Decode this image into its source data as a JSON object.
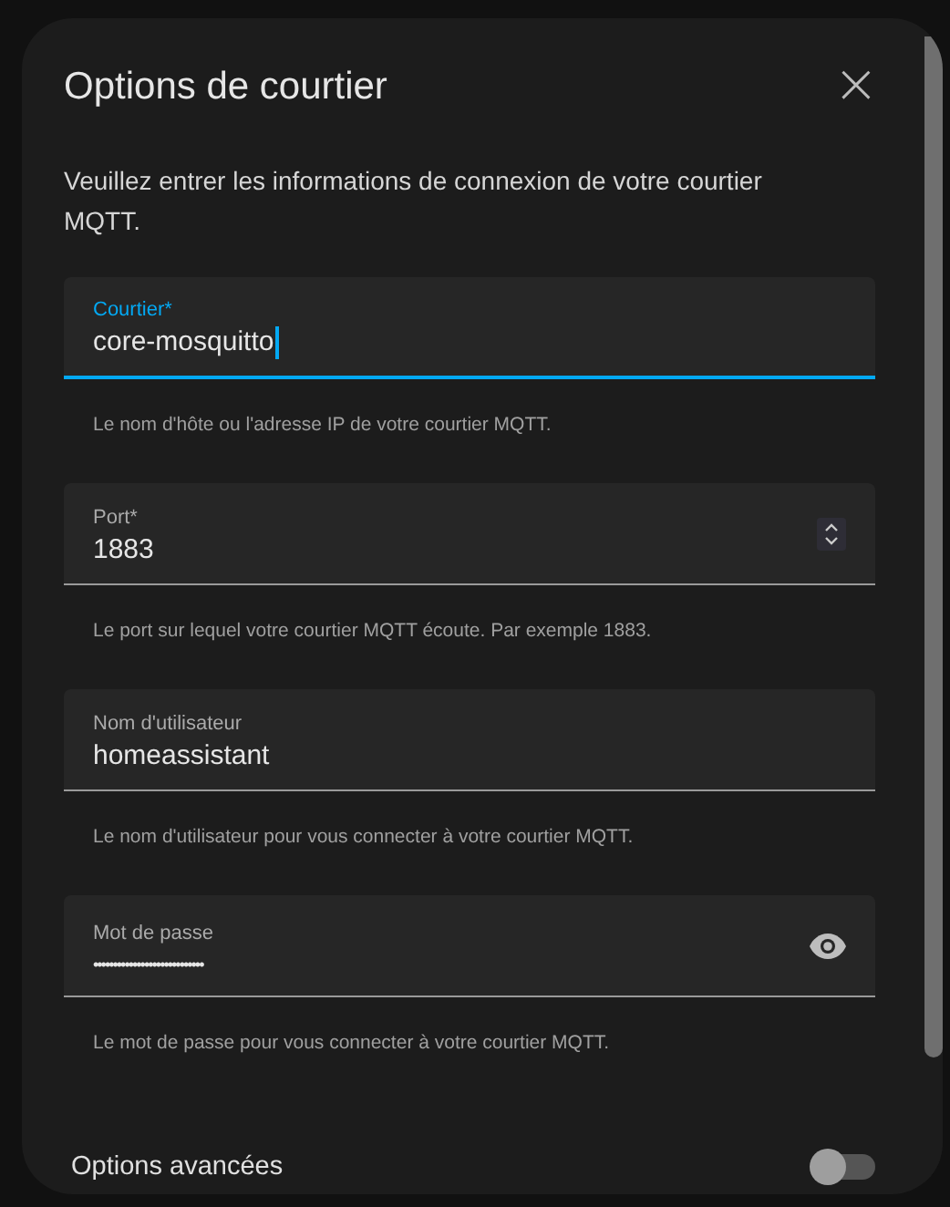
{
  "dialog": {
    "title": "Options de courtier",
    "close_icon": "×",
    "description": "Veuillez entrer les informations de connexion de votre courtier MQTT.",
    "fields": [
      {
        "kind": "text",
        "label": "Courtier*",
        "value": "core-mosquitto",
        "focused": true,
        "helper": "Le nom d'hôte ou l'adresse IP de votre courtier MQTT."
      },
      {
        "kind": "number",
        "label": "Port*",
        "value": "1883",
        "focused": false,
        "helper": "Le port sur lequel votre courtier MQTT écoute. Par exemple 1883."
      },
      {
        "kind": "text",
        "label": "Nom d'utilisateur",
        "value": "homeassistant",
        "focused": false,
        "helper": "Le nom d'utilisateur pour vous connecter à votre courtier MQTT."
      },
      {
        "kind": "password",
        "label": "Mot de passe",
        "value": "••••••••••••••••••••••••••••",
        "focused": false,
        "helper": "Le mot de passe pour vous connecter à votre courtier MQTT."
      }
    ],
    "advanced": {
      "label": "Options avancées",
      "on": false
    }
  }
}
